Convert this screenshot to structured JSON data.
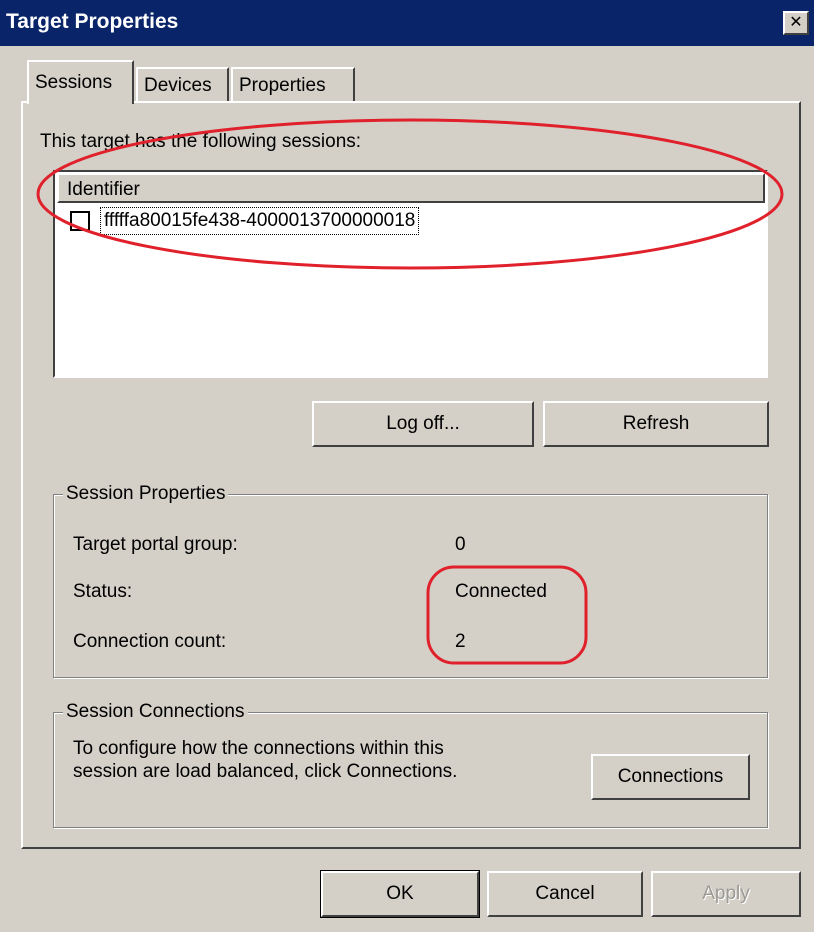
{
  "window": {
    "title": "Target Properties",
    "close_icon": "close-icon",
    "close_glyph": "✕"
  },
  "tabs": [
    {
      "label": "Sessions",
      "active": true
    },
    {
      "label": "Devices",
      "active": false
    },
    {
      "label": "Properties",
      "active": false
    }
  ],
  "sessions": {
    "label": "This target has the following sessions:",
    "list": {
      "column_header": "Identifier",
      "rows": [
        {
          "identifier": "fffffa80015fe438-4000013700000018",
          "checked": false
        }
      ]
    },
    "buttons": {
      "logoff": "Log off...",
      "refresh": "Refresh"
    }
  },
  "session_properties": {
    "title": "Session Properties",
    "rows": [
      {
        "label": "Target portal group:",
        "value": "0"
      },
      {
        "label": "Status:",
        "value": "Connected"
      },
      {
        "label": "Connection count:",
        "value": "2"
      }
    ]
  },
  "session_connections": {
    "title": "Session Connections",
    "description": "To configure how the connections within this session are load balanced, click Connections.",
    "button": "Connections"
  },
  "footer": {
    "ok": "OK",
    "cancel": "Cancel",
    "apply": "Apply",
    "apply_enabled": false
  },
  "annotations": {
    "color": "#e0202a"
  },
  "colors": {
    "titlebar": "#0a246a",
    "face": "#d4d0c8"
  }
}
